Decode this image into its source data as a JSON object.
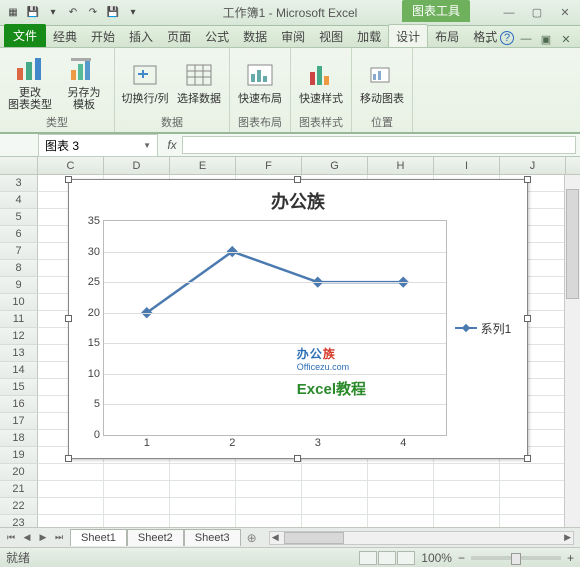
{
  "window": {
    "title": "工作簿1 - Microsoft Excel",
    "chart_tools_label": "图表工具"
  },
  "tabs": {
    "file": "文件",
    "items": [
      "经典",
      "开始",
      "插入",
      "页面",
      "公式",
      "数据",
      "审阅",
      "视图",
      "加载",
      "设计",
      "布局",
      "格式"
    ],
    "active": "设计"
  },
  "ribbon": {
    "groups": [
      {
        "label": "类型",
        "buttons": [
          {
            "id": "change-chart-type",
            "label": "更改\n图表类型"
          },
          {
            "id": "save-as-template",
            "label": "另存为\n模板"
          }
        ]
      },
      {
        "label": "数据",
        "buttons": [
          {
            "id": "switch-row-col",
            "label": "切换行/列"
          },
          {
            "id": "select-data",
            "label": "选择数据"
          }
        ]
      },
      {
        "label": "图表布局",
        "buttons": [
          {
            "id": "quick-layout",
            "label": "快速布局"
          }
        ]
      },
      {
        "label": "图表样式",
        "buttons": [
          {
            "id": "quick-styles",
            "label": "快速样式"
          }
        ]
      },
      {
        "label": "位置",
        "buttons": [
          {
            "id": "move-chart",
            "label": "移动图表"
          }
        ]
      }
    ]
  },
  "formula_bar": {
    "name_box": "图表 3",
    "fx": "fx",
    "value": ""
  },
  "grid": {
    "columns": [
      "C",
      "D",
      "E",
      "F",
      "G",
      "H",
      "I",
      "J"
    ],
    "row_start": 3,
    "row_end": 23
  },
  "chart_data": {
    "type": "line",
    "title": "办公族",
    "categories": [
      "1",
      "2",
      "3",
      "4"
    ],
    "series": [
      {
        "name": "系列1",
        "values": [
          20,
          30,
          25,
          25
        ]
      }
    ],
    "ylim": [
      0,
      35
    ],
    "ystep": 5,
    "xlabel": "",
    "ylabel": ""
  },
  "watermark": {
    "line1_a": "办公",
    "line1_b": "族",
    "line2": "Officezu.com",
    "line3": "Excel教程"
  },
  "sheet_tabs": [
    "Sheet1",
    "Sheet2",
    "Sheet3"
  ],
  "status": {
    "ready": "就绪",
    "zoom": "100%"
  }
}
